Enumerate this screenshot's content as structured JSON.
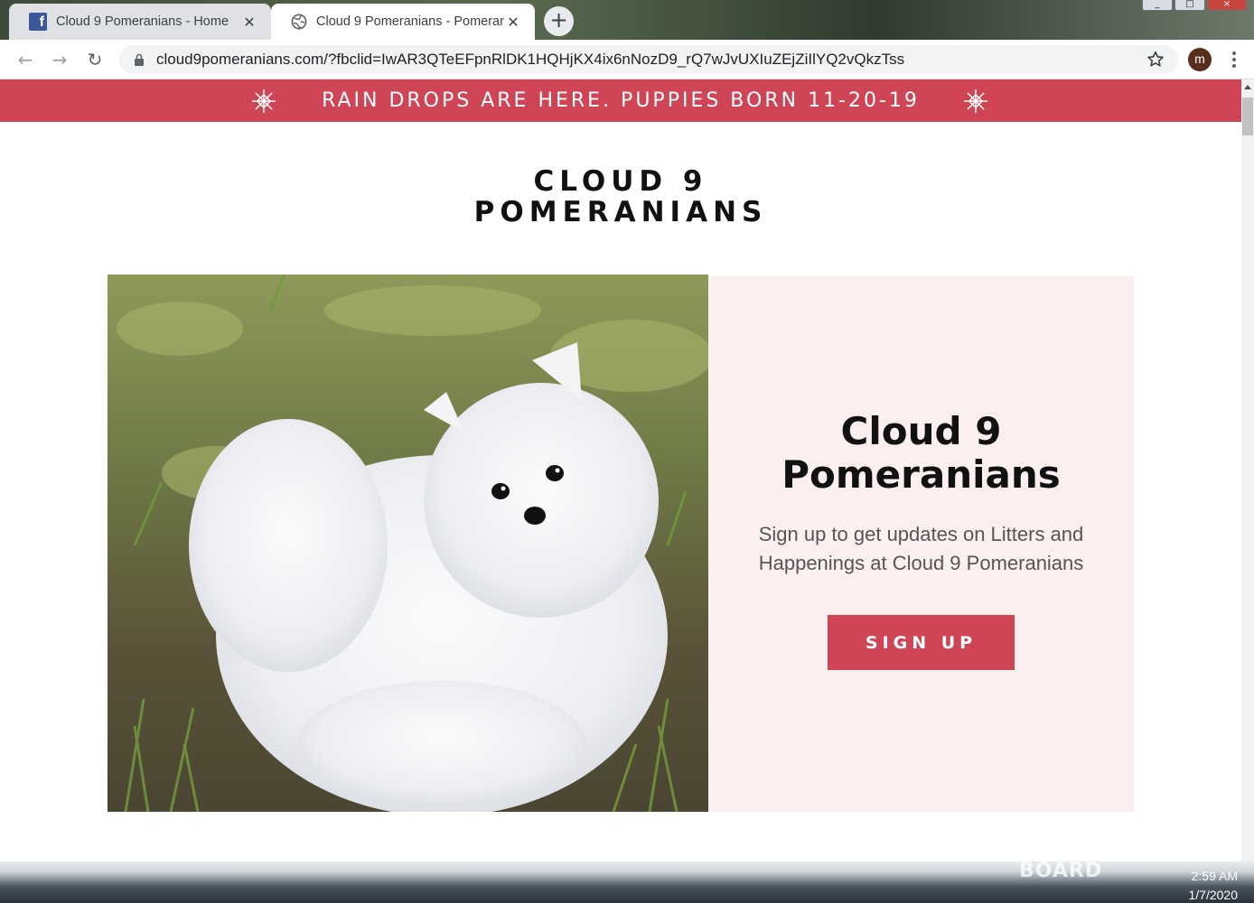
{
  "browser": {
    "tabs": [
      {
        "title": "Cloud 9 Pomeranians - Home",
        "icon": "facebook-icon",
        "active": false
      },
      {
        "title": "Cloud 9 Pomeranians - Pomerani",
        "icon": "globe-icon",
        "active": true
      }
    ],
    "address": "cloud9pomeranians.com/?fbclid=IwAR3QTeEFpnRlDK1HQHjKX4ix6nNozD9_rQ7wJvUXIuZEjZiIlYQ2vQkzTss",
    "profile_initial": "m"
  },
  "page": {
    "announcement": "RAIN DROPS ARE HERE. PUPPIES BORN 11-20-19",
    "site_title": "CLOUD 9\nPOMERANIANS",
    "hero": {
      "heading": "Cloud 9\nPomeranians",
      "text": "Sign up to get updates on Litters and Happenings at Cloud 9 Pomeranians",
      "button": "SIGN UP",
      "image": "white-pomeranian-puppy-on-grass"
    },
    "colors": {
      "accent": "#cf4556",
      "panel": "#fbefef"
    }
  },
  "taskbar": {
    "watermark": "BOARD",
    "time": "2:59 AM",
    "date": "1/7/2020"
  }
}
